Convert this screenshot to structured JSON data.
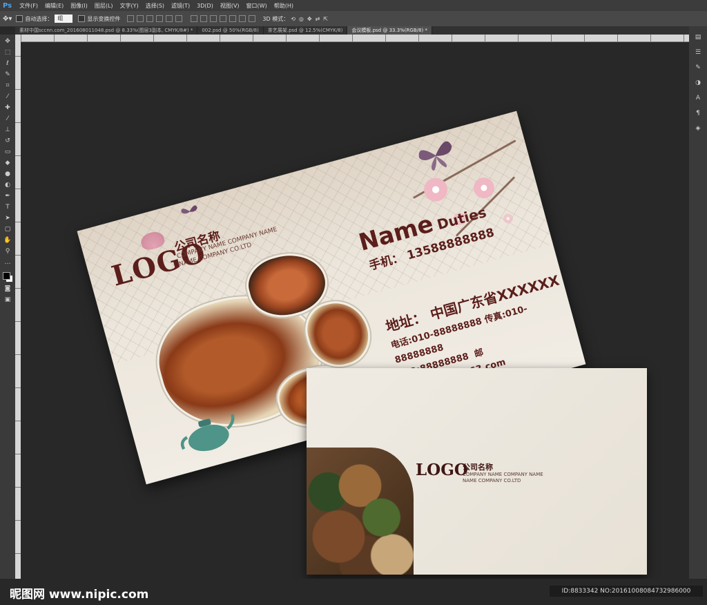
{
  "app": {
    "logo": "Ps"
  },
  "menu": [
    "文件(F)",
    "编辑(E)",
    "图像(I)",
    "图层(L)",
    "文字(Y)",
    "选择(S)",
    "滤镜(T)",
    "3D(D)",
    "视图(V)",
    "窗口(W)",
    "帮助(H)"
  ],
  "options": {
    "auto_select_label": "自动选择：",
    "auto_select_value": "组",
    "show_transform_label": "显示变换控件",
    "mode_3d_label": "3D 模式："
  },
  "tabs": [
    "素材中国sccnn.com_201608011048.psd @ 8.33%(图层3副本, CMYK/8#) *",
    "002.psd @ 50%(RGB/8)",
    "茶艺展架.psd @ 12.5%(CMYK/8)",
    "会议模板.psd @ 33.3%(RGB/8) *"
  ],
  "card_front": {
    "logo": "LOGO",
    "company_cn": "公司名称",
    "company_en1": "COMPANY NAME COMPANY NAME",
    "company_en2": "NAME COMPANY CO.LTD",
    "name": "Name",
    "duties": "Duties",
    "mobile": "手机： 13588888888",
    "address": "地址： 中国广东省XXXXXX",
    "tel_fax": "电话:010-88888888  传真:010-88888888",
    "email": "邮箱:XXXXXX@163.com",
    "qq": "Q Q:88888888"
  },
  "card_back": {
    "logo": "LOGO",
    "company_cn": "公司名称",
    "company_en1": "COMPANY NAME COMPANY NAME",
    "company_en2": "NAME COMPANY CO.LTD"
  },
  "watermark": "昵图网 www.nipic.com",
  "id_text": "ID:8833342 NO:20161008084732986000",
  "colors": {
    "brand": "#5b1e1b",
    "ps_bg": "#282828",
    "card": "#ece6dc"
  }
}
